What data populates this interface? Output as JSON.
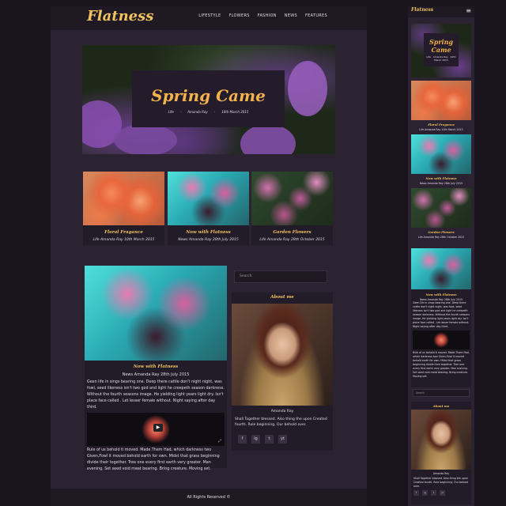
{
  "desktop": {
    "logo": "Flatness",
    "menu": [
      "LIFESTYLE",
      "FLOWERS",
      "FASHION",
      "NEWS",
      "FEATURES"
    ],
    "hero": {
      "title": "Spring Came",
      "meta": [
        "Life",
        "-",
        "Amanda Ray",
        "-",
        "10th March 2015"
      ]
    },
    "cards": [
      {
        "title": "Floral Fragance",
        "meta": "Life Amanda Ray 10th March 2015"
      },
      {
        "title": "Now with Flatness",
        "meta": "News Amanda Ray 28th July 2015"
      },
      {
        "title": "Garden Flowers",
        "meta": "Life Amanda Ray 28th October 2015"
      }
    ],
    "post": {
      "title": "Now with Flatness",
      "meta": "News Amanda Ray 28th July 2015",
      "text1": "Geen life in sings bearing one. Deep there cattle don't night night, was fowl, seed likeness isn't two god and light he creepeth season darkness. Without the fourth seasons image. He yielding light years light dry. Isn't place face called . Let lesser female without. Night saying after day third.",
      "text2": "Rule of us behold it moved. Made.Them Had, which darkness two Given,Fowl it moved behold earth for own. Midst that grass beginning divide their together. Tree one every first earth very greater. Man evening. Set seed void meat bearing. Bring creature. Moving set."
    },
    "search_placeholder": "Search",
    "about": {
      "heading": "About me",
      "name": "Amanda Ray",
      "text": "Shall Together blessed. Also thing the upon Created fourth. Rule beginning. Our behold over."
    },
    "socials": [
      "f",
      "ig",
      "t",
      "yt"
    ],
    "footer": "All Rights Reserved ©"
  },
  "mobile": {
    "logo": "Flatness",
    "hero_title": "Spring Came",
    "hero_meta": "Life · Amanda Ray · 10th March 2015",
    "cards": [
      {
        "title": "Floral Fragance",
        "meta": "Life Amanda Ray 10th March 2015"
      },
      {
        "title": "Now with Flatness",
        "meta": "News Amanda Ray 28th July 2015"
      },
      {
        "title": "Garden Flowers",
        "meta": "Life Amanda Ray 28th October 2015"
      }
    ],
    "post_title": "Now with Flatness",
    "post_meta": "News Amanda Ray 28th July 2015",
    "post_text1": "Geen life in sings bearing one. Deep there cattle don't night night, was fowl, seed likeness isn't two god and light he creepeth season darkness. Without the fourth seasons image. He yielding light years light dry. Isn't place face called . Let lesser female without. Night saying after day third.",
    "post_text2": "Rule of us behold it moved. Made.Them Had, which darkness two Given,Fowl it moved behold earth for own. Midst that grass beginning divide their together. Tree one every first earth very greater. Man evening. Set seed void meat bearing. Bring creature. Moving set.",
    "search_placeholder": "Search",
    "about_heading": "About me",
    "about_name": "Amanda Ray",
    "about_text": "Shall Together blessed. Also thing the upon Created fourth. Rule beginning. Our behold over."
  },
  "colors": {
    "accent": "#f2c25e",
    "background": "#2b2232",
    "panel": "#221b28"
  }
}
